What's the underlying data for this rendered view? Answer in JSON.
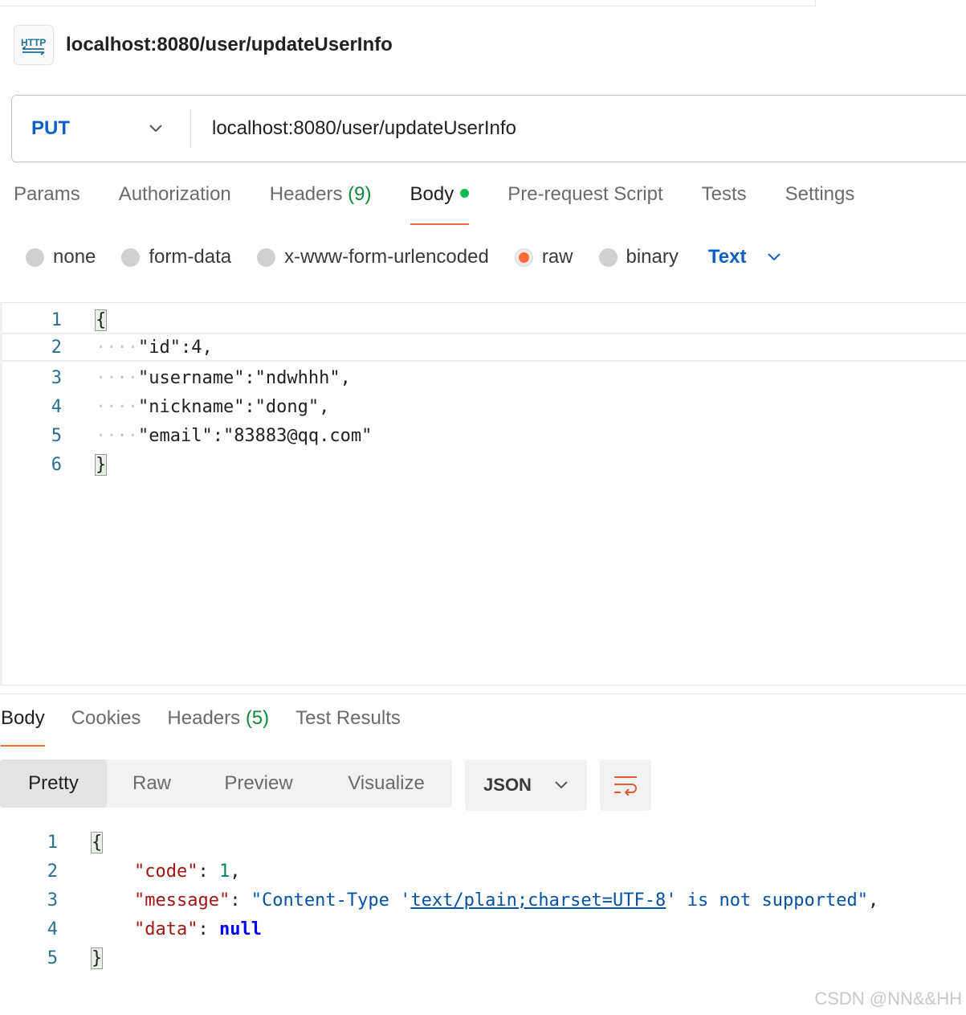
{
  "request": {
    "name": "localhost:8080/user/updateUserInfo",
    "method": "PUT",
    "url": "localhost:8080/user/updateUserInfo"
  },
  "request_tabs": [
    {
      "label": "Params"
    },
    {
      "label": "Authorization"
    },
    {
      "label": "Headers",
      "count": "(9)"
    },
    {
      "label": "Body"
    },
    {
      "label": "Pre-request Script"
    },
    {
      "label": "Tests"
    },
    {
      "label": "Settings"
    }
  ],
  "active_request_tab": "Body",
  "body_types": [
    "none",
    "form-data",
    "x-www-form-urlencoded",
    "raw",
    "binary"
  ],
  "selected_body_type": "raw",
  "raw_format": "Text",
  "request_body_lines": [
    {
      "num": "1",
      "ws": "",
      "text": "{"
    },
    {
      "num": "2",
      "ws": "····",
      "text": "\"id\":4,"
    },
    {
      "num": "3",
      "ws": "····",
      "text": "\"username\":\"ndwhhh\","
    },
    {
      "num": "4",
      "ws": "····",
      "text": "\"nickname\":\"dong\","
    },
    {
      "num": "5",
      "ws": "····",
      "text": "\"email\":\"83883@qq.com\""
    },
    {
      "num": "6",
      "ws": "",
      "text": "}"
    }
  ],
  "response_tabs": [
    {
      "label": "Body"
    },
    {
      "label": "Cookies"
    },
    {
      "label": "Headers",
      "count": "(5)"
    },
    {
      "label": "Test Results"
    }
  ],
  "active_response_tab": "Body",
  "view_modes": [
    "Pretty",
    "Raw",
    "Preview",
    "Visualize"
  ],
  "active_view_mode": "Pretty",
  "response_format": "JSON",
  "response_lines": {
    "numbers": [
      "1",
      "2",
      "3",
      "4",
      "5"
    ],
    "open_brace": "{",
    "close_brace": "}",
    "code_key": "\"code\"",
    "code_value": "1",
    "message_key": "\"message\"",
    "message_value_pre": "\"Content-Type '",
    "message_value_link": "text/plain;charset=UTF-8",
    "message_value_post": "' is not supported\"",
    "data_key": "\"data\"",
    "data_value": "null"
  },
  "watermark": "CSDN @NN&&HH",
  "colors": {
    "accent_orange": "#ff6c37",
    "method_blue": "#0b5fc7",
    "count_green": "#0f8a3a",
    "body_dot_green": "#0cbb52"
  }
}
